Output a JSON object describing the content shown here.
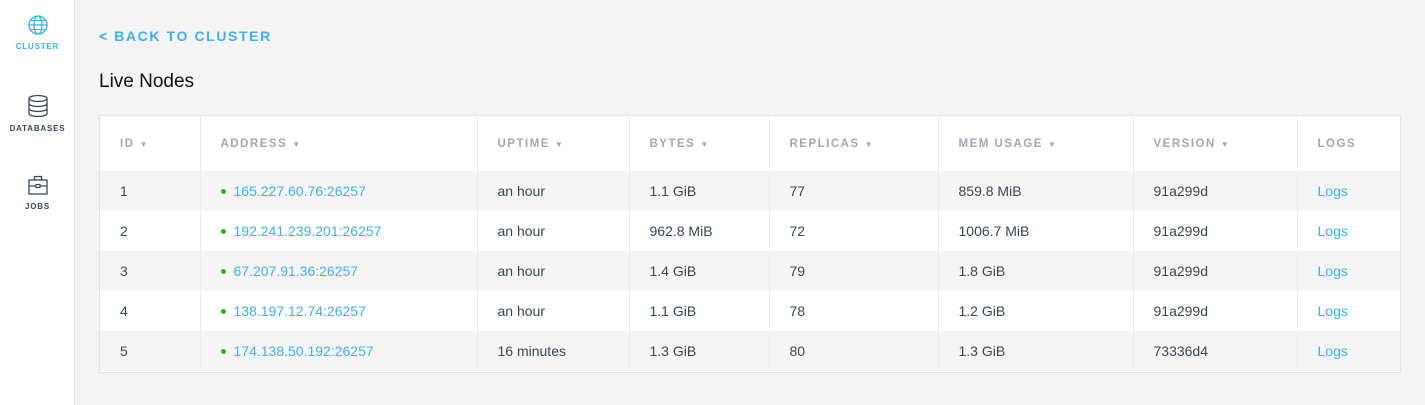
{
  "sidebar": {
    "items": [
      {
        "label": "CLUSTER",
        "icon": "globe-icon",
        "active": true
      },
      {
        "label": "DATABASES",
        "icon": "database-icon",
        "active": false
      },
      {
        "label": "JOBS",
        "icon": "briefcase-icon",
        "active": false
      }
    ]
  },
  "back_link": "< BACK TO CLUSTER",
  "page_title": "Live Nodes",
  "table": {
    "columns": [
      {
        "label": "ID",
        "sortable": true
      },
      {
        "label": "ADDRESS",
        "sortable": true
      },
      {
        "label": "UPTIME",
        "sortable": true
      },
      {
        "label": "BYTES",
        "sortable": true
      },
      {
        "label": "REPLICAS",
        "sortable": true
      },
      {
        "label": "MEM USAGE",
        "sortable": true
      },
      {
        "label": "VERSION",
        "sortable": true
      },
      {
        "label": "LOGS",
        "sortable": false
      }
    ],
    "sort_caret": "▼",
    "rows": [
      {
        "id": "1",
        "address": "165.227.60.76:26257",
        "uptime": "an hour",
        "bytes": "1.1 GiB",
        "replicas": "77",
        "mem_usage": "859.8 MiB",
        "version": "91a299d",
        "logs": "Logs"
      },
      {
        "id": "2",
        "address": "192.241.239.201:26257",
        "uptime": "an hour",
        "bytes": "962.8 MiB",
        "replicas": "72",
        "mem_usage": "1006.7 MiB",
        "version": "91a299d",
        "logs": "Logs"
      },
      {
        "id": "3",
        "address": "67.207.91.36:26257",
        "uptime": "an hour",
        "bytes": "1.4 GiB",
        "replicas": "79",
        "mem_usage": "1.8 GiB",
        "version": "91a299d",
        "logs": "Logs"
      },
      {
        "id": "4",
        "address": "138.197.12.74:26257",
        "uptime": "an hour",
        "bytes": "1.1 GiB",
        "replicas": "78",
        "mem_usage": "1.2 GiB",
        "version": "91a299d",
        "logs": "Logs"
      },
      {
        "id": "5",
        "address": "174.138.50.192:26257",
        "uptime": "16 minutes",
        "bytes": "1.3 GiB",
        "replicas": "80",
        "mem_usage": "1.3 GiB",
        "version": "73336d4",
        "logs": "Logs"
      }
    ]
  },
  "colors": {
    "accent": "#40b0ea",
    "status_live": "#37a82b",
    "header_text": "#a3a8b0",
    "body_text": "#3a4656"
  }
}
